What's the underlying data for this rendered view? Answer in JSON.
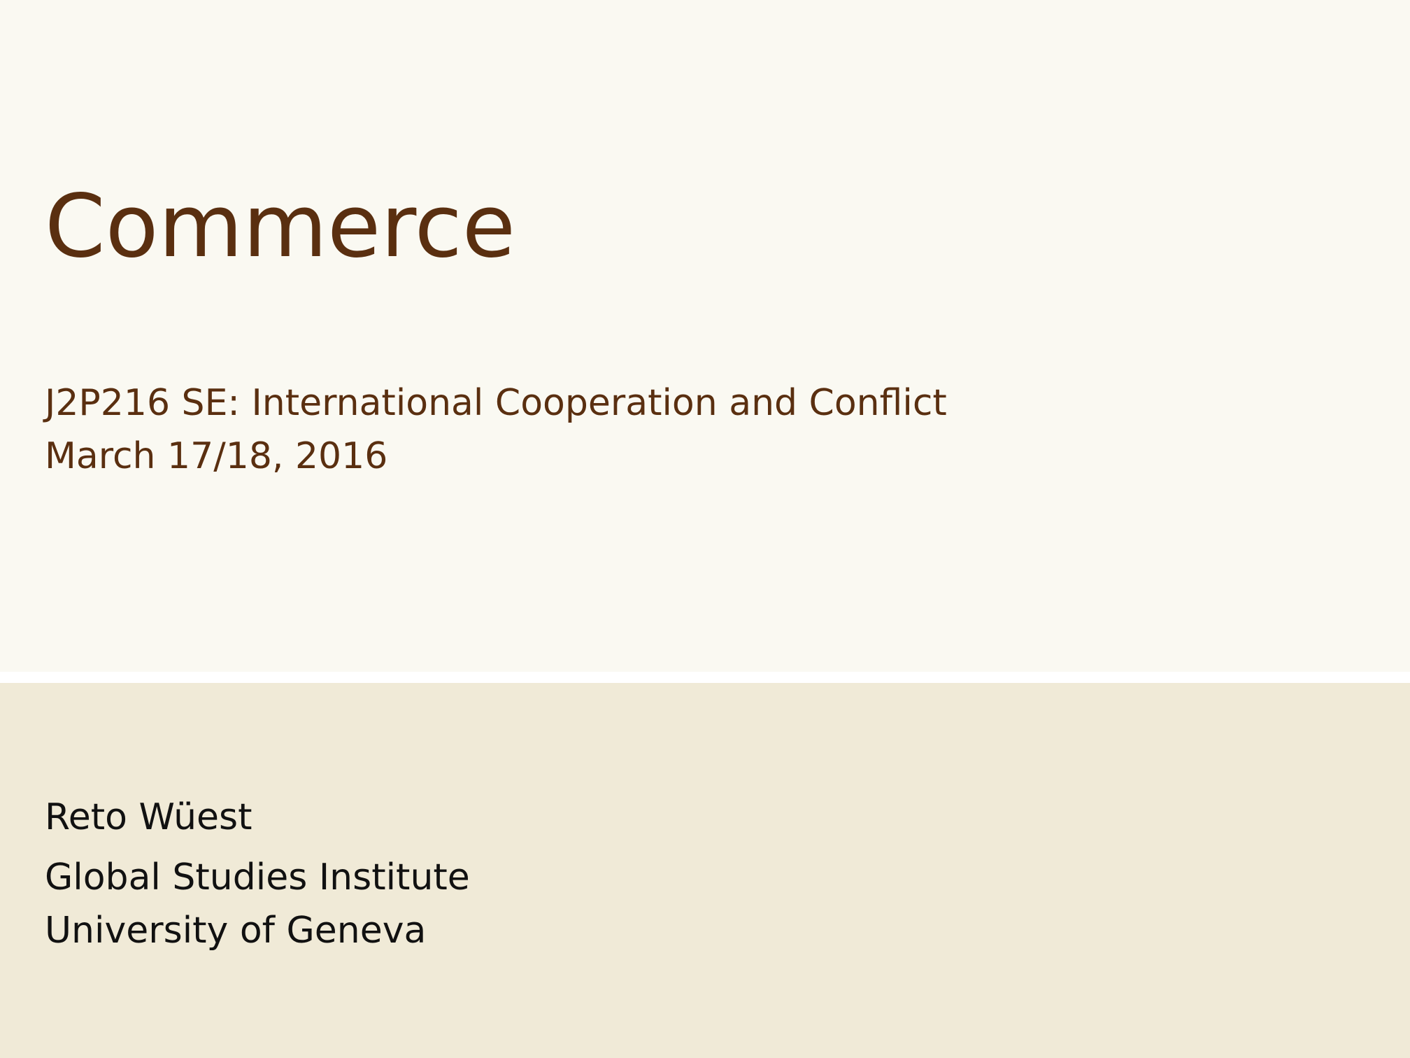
{
  "slide": {
    "title": "Commerce",
    "course": "J2P216 SE: International Cooperation and Conflict",
    "date": "March 17/18, 2016",
    "author": "Reto Wüest",
    "institute": "Global Studies Institute",
    "university": "University of Geneva"
  },
  "colors": {
    "title_text": "#5A2F10",
    "body_text": "#111111",
    "top_background": "#FAF9F2",
    "bottom_background": "#F0EAD7",
    "divider": "#FFFFFF"
  }
}
